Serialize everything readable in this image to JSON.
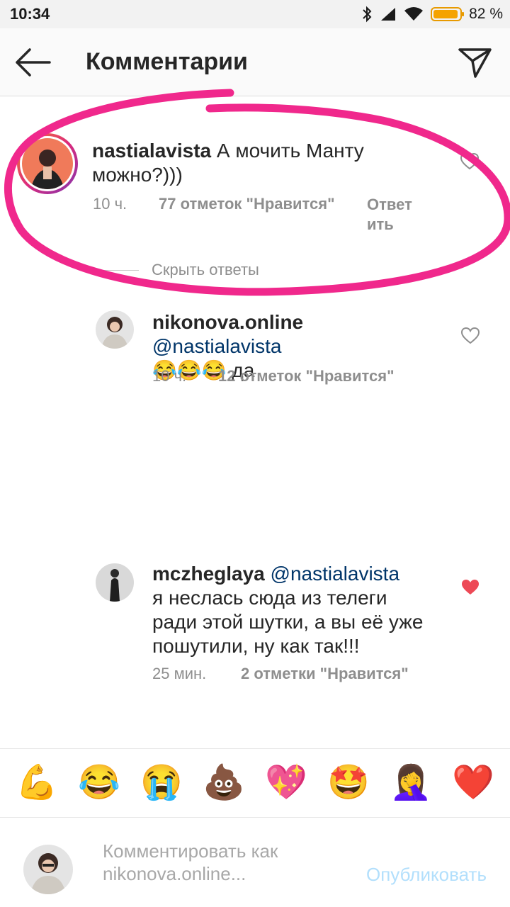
{
  "status_bar": {
    "time": "10:34",
    "battery_pct": "82 %",
    "battery_level": 0.82
  },
  "header": {
    "title": "Комментарии"
  },
  "icons": {
    "back": "arrow-left-icon",
    "send": "paper-plane-icon",
    "like": "heart-icon"
  },
  "colors": {
    "accent_pink": "#f0288c",
    "liked_heart": "#ed4956",
    "link_blue": "#003569",
    "publish_blue": "#b2dffc"
  },
  "comments": [
    {
      "username": "nastialavista",
      "text": " А мочить Манту можно?)))",
      "time": "10 ч.",
      "likes": "77 отметок \"Нравится\"",
      "reply": "Ответить",
      "reply_line1": "Ответ",
      "reply_line2": "ить",
      "liked": false
    }
  ],
  "hide_replies": "Скрыть ответы",
  "replies": [
    {
      "username": "nikonova.online",
      "mention": "@nastialavista",
      "text": "😂😂😂 да",
      "time": "10 ч.",
      "likes": "12 отметок \"Нравится\"",
      "liked": false
    },
    {
      "username": "mczheglaya",
      "mention": "@nastialavista",
      "text": "я неслась сюда из телеги ради этой шутки, а вы её уже пошутили, ну как так!!!",
      "time": "25 мин.",
      "likes": "2 отметки \"Нравится\"",
      "liked": true
    }
  ],
  "emoji_bar": [
    "💪",
    "😂",
    "😭",
    "💩",
    "💖",
    "🤩",
    "🤦‍♀️",
    "❤️"
  ],
  "composer": {
    "placeholder": "Комментировать как nikonova.online...",
    "publish": "Опубликовать"
  }
}
